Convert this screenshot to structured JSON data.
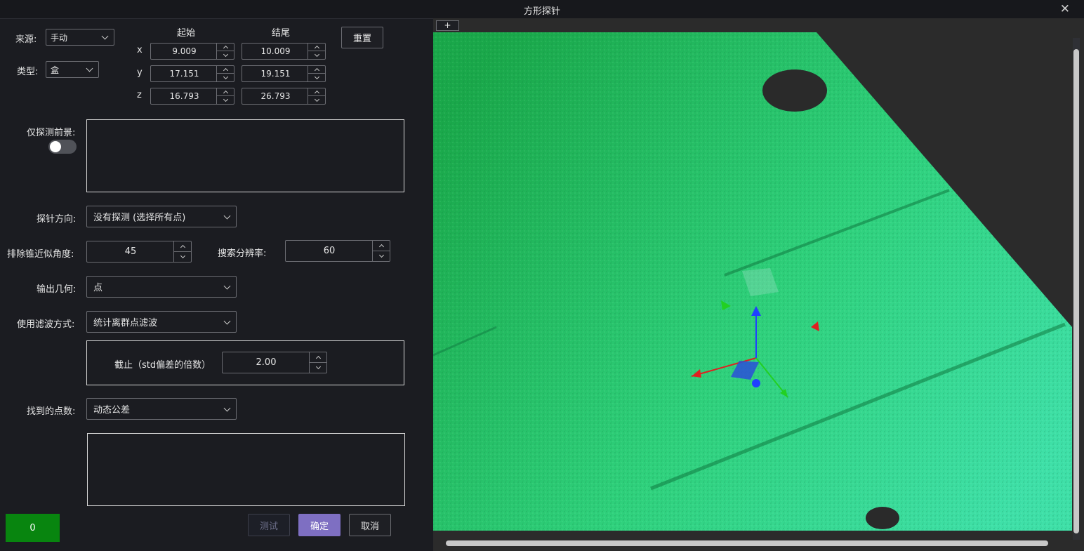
{
  "window": {
    "title": "方形探针",
    "close_glyph": "✕"
  },
  "source": {
    "label": "来源:",
    "value": "手动"
  },
  "type": {
    "label": "类型:",
    "value": "盒"
  },
  "range": {
    "start_header": "起始",
    "end_header": "结尾",
    "rows": [
      {
        "axis": "x",
        "start": "9.009",
        "end": "10.009"
      },
      {
        "axis": "y",
        "start": "17.151",
        "end": "19.151"
      },
      {
        "axis": "z",
        "start": "16.793",
        "end": "26.793"
      }
    ],
    "reset_label": "重置"
  },
  "foreground": {
    "label": "仅探测前景:",
    "toggle_on": false
  },
  "probe_direction": {
    "label": "探针方向:",
    "value": "没有探测 (选择所有点)"
  },
  "exclude_cone": {
    "label": "排除锥近似角度:",
    "value": "45"
  },
  "search_resolution": {
    "label": "搜索分辨率:",
    "value": "60"
  },
  "output_geometry": {
    "label": "输出几何:",
    "value": "点"
  },
  "filter": {
    "label": "使用滤波方式:",
    "value": "统计离群点滤波",
    "cutoff_label": "截止（std偏差的倍数）",
    "cutoff_value": "2.00"
  },
  "found_points": {
    "label": "找到的点数:",
    "value": "动态公差"
  },
  "counter_value": "0",
  "buttons": {
    "test": "测试",
    "ok": "确定",
    "cancel": "取消"
  },
  "viewer": {
    "add_tab_label": "+",
    "cloud_colors": [
      "#1aa84a",
      "#2fd17c",
      "#3fe0a8"
    ],
    "background": "#2b2b2b",
    "gizmo": {
      "x_axis_color": "#e02020",
      "y_axis_color": "#22d022",
      "z_axis_color": "#2040ff"
    }
  }
}
